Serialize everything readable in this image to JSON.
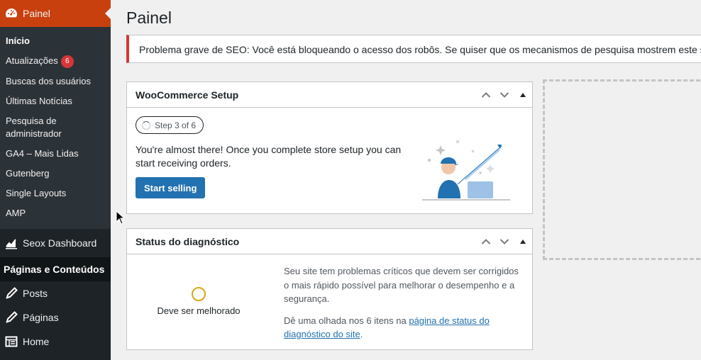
{
  "sidebar": {
    "dashboard_label": "Painel",
    "submenu": [
      {
        "label": "Início",
        "current": true
      },
      {
        "label": "Atualizações",
        "badge": "6"
      },
      {
        "label": "Buscas dos usuários"
      },
      {
        "label": "Últimas Notícias"
      },
      {
        "label": "Pesquisa de administrador"
      },
      {
        "label": "GA4 – Mais Lidas"
      },
      {
        "label": "Gutenberg"
      },
      {
        "label": "Single Layouts"
      },
      {
        "label": "AMP"
      }
    ],
    "seox_label": "Seox Dashboard",
    "section_header": "Páginas e Conteúdos",
    "items": [
      {
        "label": "Posts",
        "icon": "pin-icon"
      },
      {
        "label": "Páginas",
        "icon": "pin-icon"
      },
      {
        "label": "Home",
        "icon": "layout-icon"
      }
    ]
  },
  "main": {
    "title": "Painel",
    "notice": "Problema grave de SEO: Você está bloqueando o acesso dos robôs. Se quiser que os mecanismos de pesquisa mostrem este site em seus"
  },
  "woo_setup": {
    "title": "WooCommerce Setup",
    "step": "Step 3 of 6",
    "text": "You're almost there! Once you complete store setup you can start receiving orders.",
    "button": "Start selling"
  },
  "diagnostic": {
    "title": "Status do diagnóstico",
    "status": "Deve ser melhorado",
    "text1": "Seu site tem problemas críticos que devem ser corrigidos o mais rápido possível para melhorar o desempenho e a segurança.",
    "text2_before": "Dê uma olhada nos 6 itens na ",
    "text2_link": "página de status do diagnóstico do site",
    "text2_after": "."
  },
  "colors": {
    "sidebar_bg": "#1d2327",
    "current_menu": "#c9400f",
    "primary": "#2271b1",
    "notice_error": "#d63638"
  }
}
